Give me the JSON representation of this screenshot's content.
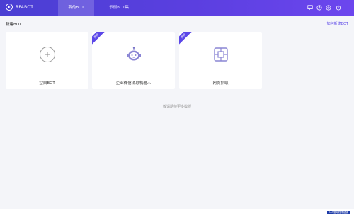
{
  "app": {
    "logo_text": "RPABOT"
  },
  "tabs": [
    {
      "label": "我的BOT",
      "active": true
    },
    {
      "label": "示例BOT集",
      "active": false
    }
  ],
  "toolbar_icons": [
    "chat-bubble-icon",
    "help-icon",
    "settings-icon",
    "power-icon"
  ],
  "content": {
    "title": "新建BOT",
    "how_link": "如何新建BOT",
    "more_text": "敬请期待更多模版"
  },
  "cards": [
    {
      "label": "空白BOT",
      "icon": "plus-icon",
      "badge": ""
    },
    {
      "label": "企业微信消息机器人",
      "icon": "robot-icon",
      "badge": "推荐"
    },
    {
      "label": "网页抓取",
      "icon": "web-grab-icon",
      "badge": "推荐"
    }
  ],
  "footer": {
    "chip": "ICU 驱动程序错误"
  },
  "colors": {
    "brand": "#5b47e8",
    "topbar_start": "#4a3fd3",
    "topbar_end": "#6c46ee",
    "page_bg": "#f4f5f9"
  }
}
